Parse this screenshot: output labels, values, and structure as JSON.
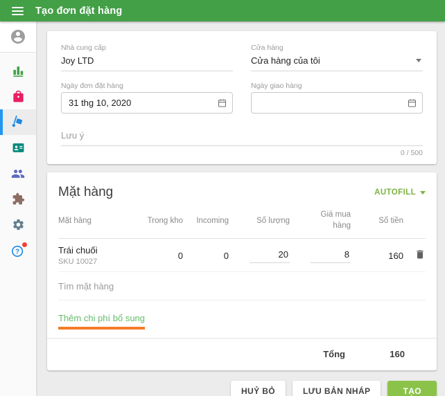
{
  "header": {
    "title": "Tạo đơn đặt hàng"
  },
  "sidebar": {
    "items": [
      {
        "icon": "avatar-icon"
      },
      {
        "icon": "bar-chart-icon"
      },
      {
        "icon": "basket-icon"
      },
      {
        "icon": "hand-truck-icon",
        "selected": true
      },
      {
        "icon": "contact-card-icon"
      },
      {
        "icon": "people-icon"
      },
      {
        "icon": "puzzle-icon"
      },
      {
        "icon": "gear-icon"
      },
      {
        "icon": "help-icon",
        "has_badge": true
      }
    ]
  },
  "form": {
    "supplier": {
      "label": "Nhà cung cấp",
      "value": "Joy LTD"
    },
    "store": {
      "label": "Cửa hàng",
      "value": "Cửa hàng của tôi"
    },
    "order_date": {
      "label": "Ngày đơn đặt hàng",
      "value": "31 thg 10, 2020"
    },
    "delivery_date": {
      "label": "Ngày giao hàng",
      "value": ""
    },
    "note": {
      "placeholder": "Lưu ý",
      "counter": "0 / 500"
    }
  },
  "items": {
    "title": "Mặt hàng",
    "autofill_label": "AUTOFILL",
    "columns": [
      "Mặt hàng",
      "Trong kho",
      "Incoming",
      "Số lượng",
      "Giá mua hàng",
      "Số tiền"
    ],
    "rows": [
      {
        "name": "Trái chuối",
        "sku": "SKU 10027",
        "in_stock": "0",
        "incoming": "0",
        "quantity": "20",
        "purchase_price": "8",
        "amount": "160"
      }
    ],
    "search_placeholder": "Tìm mặt hàng",
    "add_cost_link": "Thêm chi phí bổ sung",
    "total_label": "Tổng",
    "total_value": "160"
  },
  "actions": {
    "cancel": "HUỶ BỎ",
    "save_draft": "LƯU BẢN NHÁP",
    "create": "TẠO"
  },
  "colors": {
    "header_green": "#43a047",
    "accent_green": "#7cb342",
    "create_button_green": "#8bc34a",
    "link_green": "#66bb6a",
    "highlight_orange": "#f57c28",
    "selected_blue": "#2196f3",
    "badge_red": "#f44336"
  }
}
